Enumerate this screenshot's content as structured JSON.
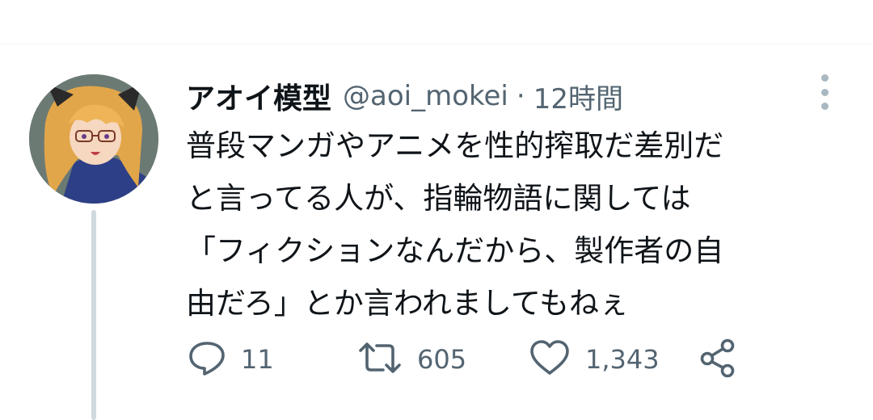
{
  "tweet": {
    "display_name": "アオイ模型",
    "handle": "@aoi_mokei",
    "separator": "·",
    "time": "12時間",
    "text_lines": [
      "普段マンガやアニメを性的搾取だ差別だ",
      "と言ってる人が、指輪物語に関しては",
      "「フィクションなんだから、製作者の自",
      "由だろ」とか言われましてもねぇ"
    ]
  },
  "actions": {
    "reply": {
      "icon": "reply-icon",
      "count": "11"
    },
    "retweet": {
      "icon": "retweet-icon",
      "count": "605"
    },
    "like": {
      "icon": "heart-icon",
      "count": "1,343"
    },
    "share": {
      "icon": "share-icon"
    }
  },
  "colors": {
    "text": "#0f1419",
    "secondary": "#536471",
    "thread_line": "#cfd9de",
    "more_dots": "#aab8c2"
  }
}
